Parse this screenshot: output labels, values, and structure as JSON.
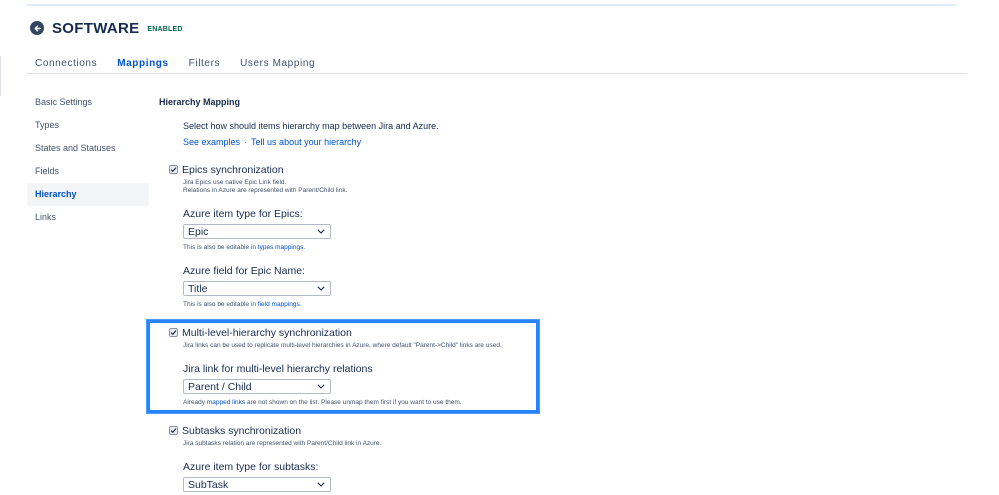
{
  "header": {
    "title": "SOFTWARE",
    "badge": "ENABLED",
    "back_icon": "arrow-left-circle-icon"
  },
  "tabs": [
    {
      "label": "Connections",
      "active": false
    },
    {
      "label": "Mappings",
      "active": true
    },
    {
      "label": "Filters",
      "active": false
    },
    {
      "label": "Users Mapping",
      "active": false
    }
  ],
  "sidebar": {
    "items": [
      {
        "label": "Basic Settings",
        "active": false
      },
      {
        "label": "Types",
        "active": false
      },
      {
        "label": "States and Statuses",
        "active": false
      },
      {
        "label": "Fields",
        "active": false
      },
      {
        "label": "Hierarchy",
        "active": true
      },
      {
        "label": "Links",
        "active": false
      }
    ]
  },
  "main": {
    "title": "Hierarchy Mapping",
    "intro": "Select how should items hierarchy map between Jira and Azure.",
    "see_examples": "See examples",
    "separator": "·",
    "tell_us": "Tell us about your hierarchy",
    "epics": {
      "checked": true,
      "title": "Epics synchronization",
      "desc_line1": "Jira Epics use native Epic Link field.",
      "desc_line2": "Relations in Azure are represented with Parent/Child link.",
      "item_type_label": "Azure item type for Epics:",
      "item_type_value": "Epic",
      "item_type_note_prefix": "This is also be editable in ",
      "item_type_note_link": "types mappings.",
      "field_label": "Azure field for Epic Name:",
      "field_value": "Title",
      "field_note_prefix": "This is also be editable in ",
      "field_note_link": "field mappings."
    },
    "multilevel": {
      "checked": true,
      "title": "Multi-level-hierarchy synchronization",
      "desc": "Jira links can be used to replicate multi-level hierarchies in Azure, where default \"Parent->Child\" links are used.",
      "link_label": "Jira link for multi-level hierarchy relations",
      "link_value": "Parent / Child",
      "note_prefix": "Already ",
      "note_link": "mapped links",
      "note_suffix": " are not shown on the list. Please unmap them first if you want to use them."
    },
    "subtasks": {
      "checked": true,
      "title": "Subtasks synchronization",
      "desc": "Jira subtasks relation are represented with Parent/Child link in Azure.",
      "item_type_label": "Azure item type for subtasks:",
      "item_type_value": "SubTask"
    }
  },
  "colors": {
    "accent": "#0052cc",
    "highlight": "#2684ff",
    "badge": "#006644",
    "text": "#172b4d"
  }
}
